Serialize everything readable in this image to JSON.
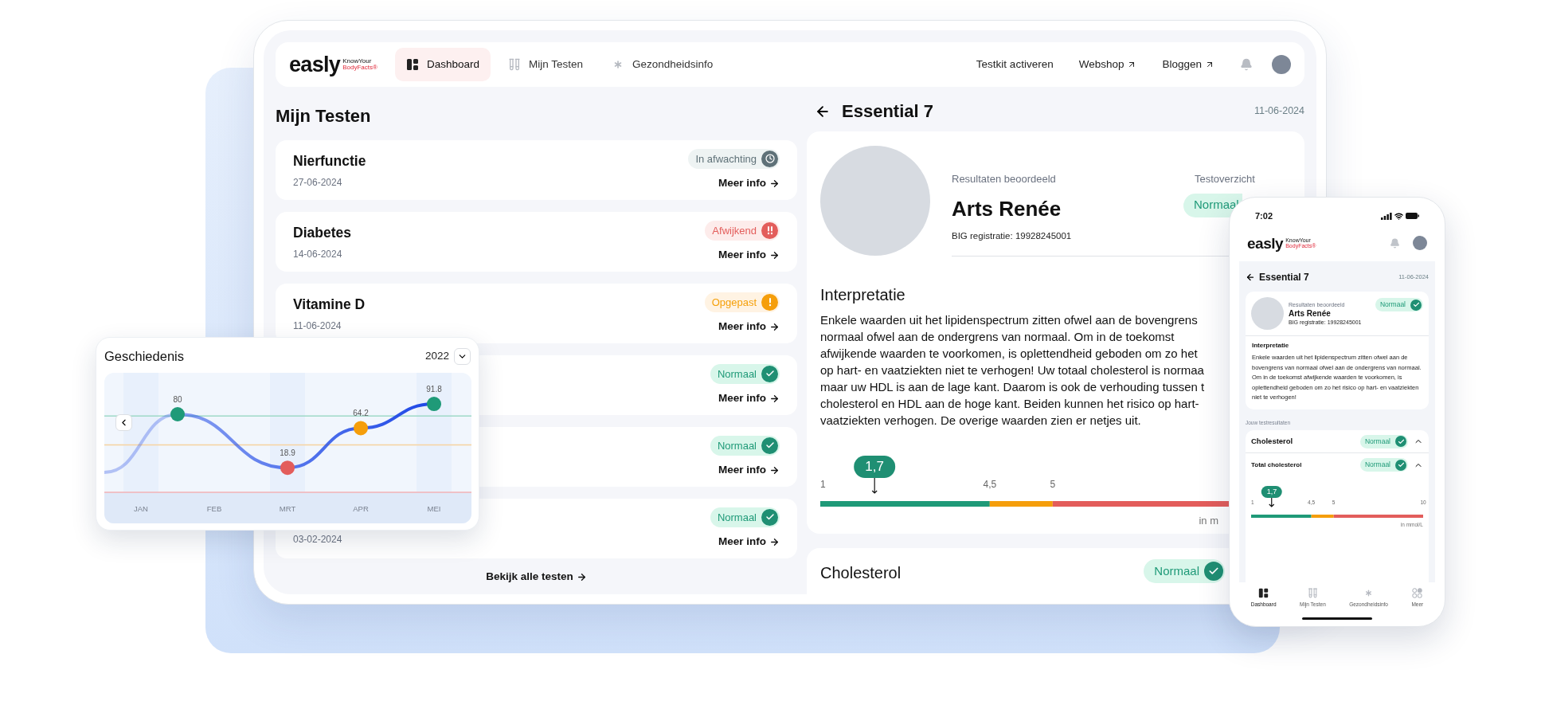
{
  "tablet": {
    "nav": {
      "logo": {
        "wordmark": "easly",
        "tagline": [
          "KnowYour",
          "BodyFacts®"
        ]
      },
      "items": [
        {
          "label": "Dashboard",
          "selected": true
        },
        {
          "label": "Mijn Testen",
          "selected": false
        },
        {
          "label": "Gezondheidsinfo",
          "selected": false
        }
      ],
      "links": [
        {
          "label": "Testkit activeren",
          "external": false
        },
        {
          "label": "Webshop",
          "external": true
        },
        {
          "label": "Bloggen",
          "external": true
        }
      ]
    },
    "list": {
      "title": "Mijn Testen",
      "tests": [
        {
          "name": "Nierfunctie",
          "date": "27-06-2024",
          "status": {
            "kind": "pending",
            "label": "In afwachting"
          },
          "link": "Meer info"
        },
        {
          "name": "Diabetes",
          "date": "14-06-2024",
          "status": {
            "kind": "abnormal",
            "label": "Afwijkend"
          },
          "link": "Meer info"
        },
        {
          "name": "Vitamine D",
          "date": "11-06-2024",
          "status": {
            "kind": "caution",
            "label": "Opgepast"
          },
          "link": "Meer info"
        },
        {
          "status": {
            "kind": "normal",
            "label": "Normaal"
          },
          "link": "Meer info"
        },
        {
          "status": {
            "kind": "normal",
            "label": "Normaal"
          },
          "link": "Meer info"
        },
        {
          "date": "03-02-2024",
          "status": {
            "kind": "normal",
            "label": "Normaal"
          },
          "link": "Meer info"
        }
      ],
      "footer_link": "Bekijk alle testen"
    },
    "detail": {
      "title": "Essential 7",
      "date": "11-06-2024",
      "reviewer": {
        "caption": "Resultaten beoordeeld",
        "name": "Arts Renée",
        "registration": "BIG registratie: 19928245001"
      },
      "overview": {
        "caption": "Testoverzicht",
        "status": {
          "kind": "normal",
          "label": "Normaal"
        }
      },
      "interpretation": {
        "title": "Interpretatie",
        "lines": [
          "Enkele waarden uit het lipidenspectrum zitten ofwel aan de bovengrens",
          "normaal ofwel aan de ondergrens van normaal. Om in de toekomst",
          "afwijkende waarden te voorkomen, is oplettendheid geboden om zo het",
          "op hart- en vaatziekten niet te verhogen! Uw totaal cholesterol is normaa",
          "maar uw HDL is aan de lage kant. Daarom is ook de verhouding tussen t",
          "cholesterol en HDL aan de hoge kant. Beiden kunnen het risico op hart-",
          "vaatziekten verhogen. De overige waarden zien er netjes uit."
        ]
      },
      "scale": {
        "marker": {
          "label": "1,7",
          "level": 0.112
        },
        "ticks": [
          "1",
          "4,5",
          "5"
        ],
        "unit": "in m"
      },
      "next_card": {
        "title": "Cholesterol",
        "status": {
          "kind": "normal",
          "label": "Normaal"
        }
      }
    }
  },
  "history_card": {
    "title": "Geschiedenis",
    "year": "2022",
    "chart_data": {
      "type": "line",
      "categories": [
        "JAN",
        null,
        "FEB",
        null,
        "MRT",
        null,
        "APR",
        null,
        "MEI"
      ],
      "series": [
        {
          "color": "#1d47e6",
          "values": [
            null,
            80,
            null,
            null,
            18.9,
            null,
            64.2,
            null,
            91.8
          ],
          "marker": true
        }
      ],
      "data_labels": true
    }
  },
  "phone": {
    "time": "7:02",
    "logo": {
      "wordmark": "easly",
      "tagline": [
        "KnowYour",
        "BodyFacts®"
      ]
    },
    "title": "Essential 7",
    "date": "11-06-2024",
    "reviewer": {
      "caption": "Resultaten beoordeeld",
      "name": "Arts Renée",
      "registration": "BIG registratie: 19928245001",
      "status": {
        "kind": "normal",
        "label": "Normaal"
      }
    },
    "interpretation": {
      "title": "Interpretatie",
      "text": "Enkele waarden uit het lipidenspectrum zitten ofwel aan de bovengrens van normaal ofwel aan de ondergrens van normaal. Om in de toekomst afwijkende waarden te voorkomen, is oplettendheid geboden om zo het risico op hart- en vaatziekten niet te verhogen!"
    },
    "results_caption": "Jouw testresultaten",
    "results": [
      {
        "title": "Cholesterol",
        "status": {
          "kind": "normal",
          "label": "Normaal"
        },
        "expanded": true
      },
      {
        "title": "Total cholesterol",
        "status": {
          "kind": "normal",
          "label": "Normaal"
        },
        "expanded": true
      }
    ],
    "scale": {
      "marker": {
        "label": "1,7",
        "level": 0.12
      },
      "ticks": [
        "1",
        "4,5",
        "5",
        "10"
      ],
      "unit": "in mmol/L"
    },
    "tabs": [
      {
        "label": "Dashboard",
        "selected": true
      },
      {
        "label": "Mijn Testen",
        "selected": false
      },
      {
        "label": "Gezondheidsinfo",
        "selected": false
      },
      {
        "label": "Meer",
        "selected": false
      }
    ]
  }
}
